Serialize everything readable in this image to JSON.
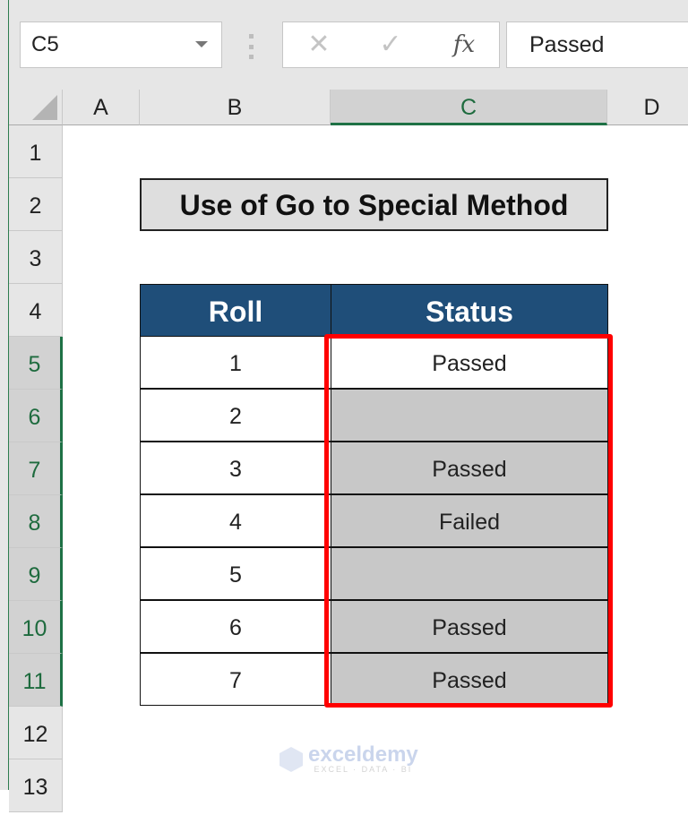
{
  "formula_bar": {
    "name_box": "C5",
    "cancel_icon": "✕",
    "enter_icon": "✓",
    "fx_label": "fx",
    "formula_value": "Passed"
  },
  "columns": [
    "A",
    "B",
    "C",
    "D"
  ],
  "selected_column": "C",
  "rows": [
    "1",
    "2",
    "3",
    "4",
    "5",
    "6",
    "7",
    "8",
    "9",
    "10",
    "11",
    "12",
    "13"
  ],
  "selected_rows": [
    "5",
    "6",
    "7",
    "8",
    "9",
    "10",
    "11"
  ],
  "sheet": {
    "title": "Use of Go to Special Method",
    "table": {
      "headers": [
        "Roll",
        "Status"
      ],
      "rows": [
        {
          "roll": "1",
          "status": "Passed"
        },
        {
          "roll": "2",
          "status": ""
        },
        {
          "roll": "3",
          "status": "Passed"
        },
        {
          "roll": "4",
          "status": "Failed"
        },
        {
          "roll": "5",
          "status": ""
        },
        {
          "roll": "6",
          "status": "Passed"
        },
        {
          "roll": "7",
          "status": "Passed"
        }
      ]
    }
  },
  "colors": {
    "header_fill": "#1f4e79",
    "selection_fill": "#c8c8c8",
    "highlight_border": "#ff0000",
    "excel_green": "#1e7145"
  },
  "watermark": {
    "name": "exceldemy",
    "tagline": "EXCEL · DATA · BI"
  }
}
